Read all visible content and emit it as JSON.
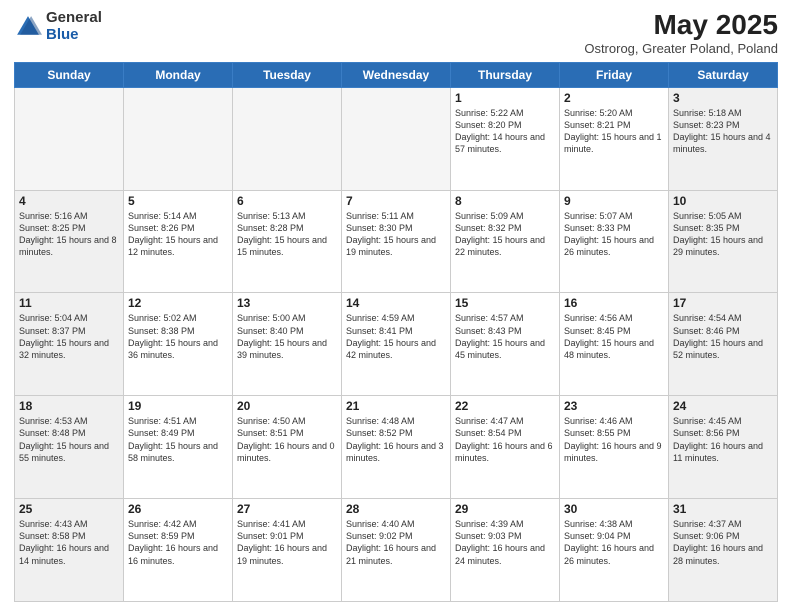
{
  "header": {
    "logo_general": "General",
    "logo_blue": "Blue",
    "month_year": "May 2025",
    "location": "Ostrorog, Greater Poland, Poland"
  },
  "weekdays": [
    "Sunday",
    "Monday",
    "Tuesday",
    "Wednesday",
    "Thursday",
    "Friday",
    "Saturday"
  ],
  "weeks": [
    [
      {
        "day": "",
        "info": "",
        "empty": true
      },
      {
        "day": "",
        "info": "",
        "empty": true
      },
      {
        "day": "",
        "info": "",
        "empty": true
      },
      {
        "day": "",
        "info": "",
        "empty": true
      },
      {
        "day": "1",
        "info": "Sunrise: 5:22 AM\nSunset: 8:20 PM\nDaylight: 14 hours and 57 minutes."
      },
      {
        "day": "2",
        "info": "Sunrise: 5:20 AM\nSunset: 8:21 PM\nDaylight: 15 hours and 1 minute."
      },
      {
        "day": "3",
        "info": "Sunrise: 5:18 AM\nSunset: 8:23 PM\nDaylight: 15 hours and 4 minutes."
      }
    ],
    [
      {
        "day": "4",
        "info": "Sunrise: 5:16 AM\nSunset: 8:25 PM\nDaylight: 15 hours and 8 minutes."
      },
      {
        "day": "5",
        "info": "Sunrise: 5:14 AM\nSunset: 8:26 PM\nDaylight: 15 hours and 12 minutes."
      },
      {
        "day": "6",
        "info": "Sunrise: 5:13 AM\nSunset: 8:28 PM\nDaylight: 15 hours and 15 minutes."
      },
      {
        "day": "7",
        "info": "Sunrise: 5:11 AM\nSunset: 8:30 PM\nDaylight: 15 hours and 19 minutes."
      },
      {
        "day": "8",
        "info": "Sunrise: 5:09 AM\nSunset: 8:32 PM\nDaylight: 15 hours and 22 minutes."
      },
      {
        "day": "9",
        "info": "Sunrise: 5:07 AM\nSunset: 8:33 PM\nDaylight: 15 hours and 26 minutes."
      },
      {
        "day": "10",
        "info": "Sunrise: 5:05 AM\nSunset: 8:35 PM\nDaylight: 15 hours and 29 minutes."
      }
    ],
    [
      {
        "day": "11",
        "info": "Sunrise: 5:04 AM\nSunset: 8:37 PM\nDaylight: 15 hours and 32 minutes."
      },
      {
        "day": "12",
        "info": "Sunrise: 5:02 AM\nSunset: 8:38 PM\nDaylight: 15 hours and 36 minutes."
      },
      {
        "day": "13",
        "info": "Sunrise: 5:00 AM\nSunset: 8:40 PM\nDaylight: 15 hours and 39 minutes."
      },
      {
        "day": "14",
        "info": "Sunrise: 4:59 AM\nSunset: 8:41 PM\nDaylight: 15 hours and 42 minutes."
      },
      {
        "day": "15",
        "info": "Sunrise: 4:57 AM\nSunset: 8:43 PM\nDaylight: 15 hours and 45 minutes."
      },
      {
        "day": "16",
        "info": "Sunrise: 4:56 AM\nSunset: 8:45 PM\nDaylight: 15 hours and 48 minutes."
      },
      {
        "day": "17",
        "info": "Sunrise: 4:54 AM\nSunset: 8:46 PM\nDaylight: 15 hours and 52 minutes."
      }
    ],
    [
      {
        "day": "18",
        "info": "Sunrise: 4:53 AM\nSunset: 8:48 PM\nDaylight: 15 hours and 55 minutes."
      },
      {
        "day": "19",
        "info": "Sunrise: 4:51 AM\nSunset: 8:49 PM\nDaylight: 15 hours and 58 minutes."
      },
      {
        "day": "20",
        "info": "Sunrise: 4:50 AM\nSunset: 8:51 PM\nDaylight: 16 hours and 0 minutes."
      },
      {
        "day": "21",
        "info": "Sunrise: 4:48 AM\nSunset: 8:52 PM\nDaylight: 16 hours and 3 minutes."
      },
      {
        "day": "22",
        "info": "Sunrise: 4:47 AM\nSunset: 8:54 PM\nDaylight: 16 hours and 6 minutes."
      },
      {
        "day": "23",
        "info": "Sunrise: 4:46 AM\nSunset: 8:55 PM\nDaylight: 16 hours and 9 minutes."
      },
      {
        "day": "24",
        "info": "Sunrise: 4:45 AM\nSunset: 8:56 PM\nDaylight: 16 hours and 11 minutes."
      }
    ],
    [
      {
        "day": "25",
        "info": "Sunrise: 4:43 AM\nSunset: 8:58 PM\nDaylight: 16 hours and 14 minutes."
      },
      {
        "day": "26",
        "info": "Sunrise: 4:42 AM\nSunset: 8:59 PM\nDaylight: 16 hours and 16 minutes."
      },
      {
        "day": "27",
        "info": "Sunrise: 4:41 AM\nSunset: 9:01 PM\nDaylight: 16 hours and 19 minutes."
      },
      {
        "day": "28",
        "info": "Sunrise: 4:40 AM\nSunset: 9:02 PM\nDaylight: 16 hours and 21 minutes."
      },
      {
        "day": "29",
        "info": "Sunrise: 4:39 AM\nSunset: 9:03 PM\nDaylight: 16 hours and 24 minutes."
      },
      {
        "day": "30",
        "info": "Sunrise: 4:38 AM\nSunset: 9:04 PM\nDaylight: 16 hours and 26 minutes."
      },
      {
        "day": "31",
        "info": "Sunrise: 4:37 AM\nSunset: 9:06 PM\nDaylight: 16 hours and 28 minutes."
      }
    ]
  ]
}
